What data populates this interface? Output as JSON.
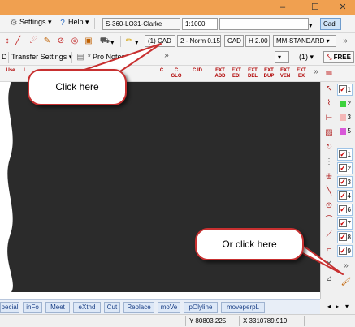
{
  "menu": {
    "settings": "Settings",
    "help": "Help"
  },
  "toolbar1": {
    "coord_system": "S-360-LO31-Clarke",
    "scale": "1:1000",
    "cad_mode": "Cad",
    "layer": "(1) CAD",
    "norm": "2 - Norm 0.15",
    "cad_btn": "CAD",
    "height": "H 2.00",
    "style": "MM-STANDARD"
  },
  "toolbar2": {
    "left_label": "D",
    "transfer_settings": "Transfer Settings",
    "pro_notes": "* Pro Notes *",
    "layer_select": "(1)",
    "free": "FREE"
  },
  "toolbar3": {
    "icons": [
      {
        "name": "use-icon",
        "label": "Use"
      },
      {
        "name": "line-icon",
        "label": "L"
      },
      {
        "name": "circle-icon",
        "label": "C"
      },
      {
        "name": "glo-icon",
        "label": "C GLO"
      },
      {
        "name": "id-icon",
        "label": "C ID"
      },
      {
        "name": "ext-add-icon",
        "label": "EXT ADD"
      },
      {
        "name": "ext-edi-icon",
        "label": "EXT EDI"
      },
      {
        "name": "ext-del-icon",
        "label": "EXT DEL"
      },
      {
        "name": "ext-dup-icon",
        "label": "EXT DUP"
      },
      {
        "name": "ext-ven-icon",
        "label": "EXT VEN"
      },
      {
        "name": "ext-ex-icon",
        "label": "EXT EX"
      }
    ]
  },
  "callouts": {
    "top": "Click here",
    "bottom": "Or click here"
  },
  "layers": [
    {
      "num": "1",
      "checked": true
    },
    {
      "num": "2",
      "color": "#3cd23c"
    },
    {
      "num": "3",
      "color": "#f4b6b6"
    },
    {
      "num": "5",
      "color": "#d858d8"
    },
    {
      "num": "1",
      "checked": true
    },
    {
      "num": "2",
      "checked": true
    },
    {
      "num": "3",
      "checked": true
    },
    {
      "num": "4",
      "checked": true
    },
    {
      "num": "6",
      "checked": true
    },
    {
      "num": "7",
      "checked": true
    },
    {
      "num": "8",
      "checked": true
    },
    {
      "num": "9",
      "checked": true
    }
  ],
  "commands": [
    "pecial",
    "inFo",
    "Meet",
    "eXtnd",
    "Cut",
    "Replace",
    "moVe",
    "pOlyline",
    "moveperpL"
  ],
  "status": {
    "y": "Y 80803.225",
    "x": "X 3310789.919"
  },
  "colors": {
    "titlebar": "#f0a050",
    "canvas": "#2b2b2b",
    "callout_border": "#c83030",
    "arrow": "#c83030"
  }
}
